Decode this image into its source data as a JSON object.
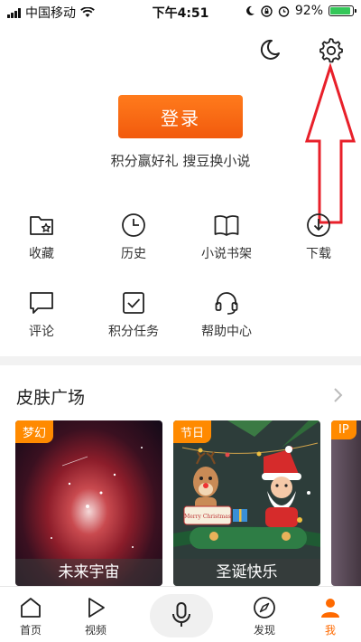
{
  "status_bar": {
    "carrier": "中国移动",
    "time": "下午4:51",
    "battery_text": "92%",
    "battery_level": 0.92
  },
  "icons": {
    "night_mode": "moon-icon",
    "settings": "gear-icon",
    "annotation": "red-arrow-icon"
  },
  "login": {
    "button_label": "登录",
    "promo_text": "积分赢好礼 搜豆换小说"
  },
  "grid": [
    {
      "label": "收藏",
      "icon": "folder-star-icon"
    },
    {
      "label": "历史",
      "icon": "clock-icon"
    },
    {
      "label": "小说书架",
      "icon": "book-icon"
    },
    {
      "label": "下载",
      "icon": "download-icon"
    },
    {
      "label": "评论",
      "icon": "comment-icon"
    },
    {
      "label": "积分任务",
      "icon": "checkbox-icon"
    },
    {
      "label": "帮助中心",
      "icon": "headset-icon"
    }
  ],
  "skins": {
    "title": "皮肤广场",
    "cards": [
      {
        "badge": "梦幻",
        "caption": "未来宇宙"
      },
      {
        "badge": "节日",
        "caption": "圣诞快乐"
      },
      {
        "badge": "IP",
        "caption": ""
      }
    ],
    "christmas_sign": "Merry Christmas"
  },
  "bottom_nav": [
    {
      "label": "首页",
      "icon": "home-icon"
    },
    {
      "label": "视频",
      "icon": "play-icon"
    },
    {
      "label": "",
      "icon": "microphone-icon"
    },
    {
      "label": "发现",
      "icon": "compass-icon"
    },
    {
      "label": "我",
      "icon": "person-icon"
    }
  ],
  "colors": {
    "accent": "#f26a10",
    "annotation_red": "#e8202a",
    "active_tab": "#ff6a00"
  }
}
